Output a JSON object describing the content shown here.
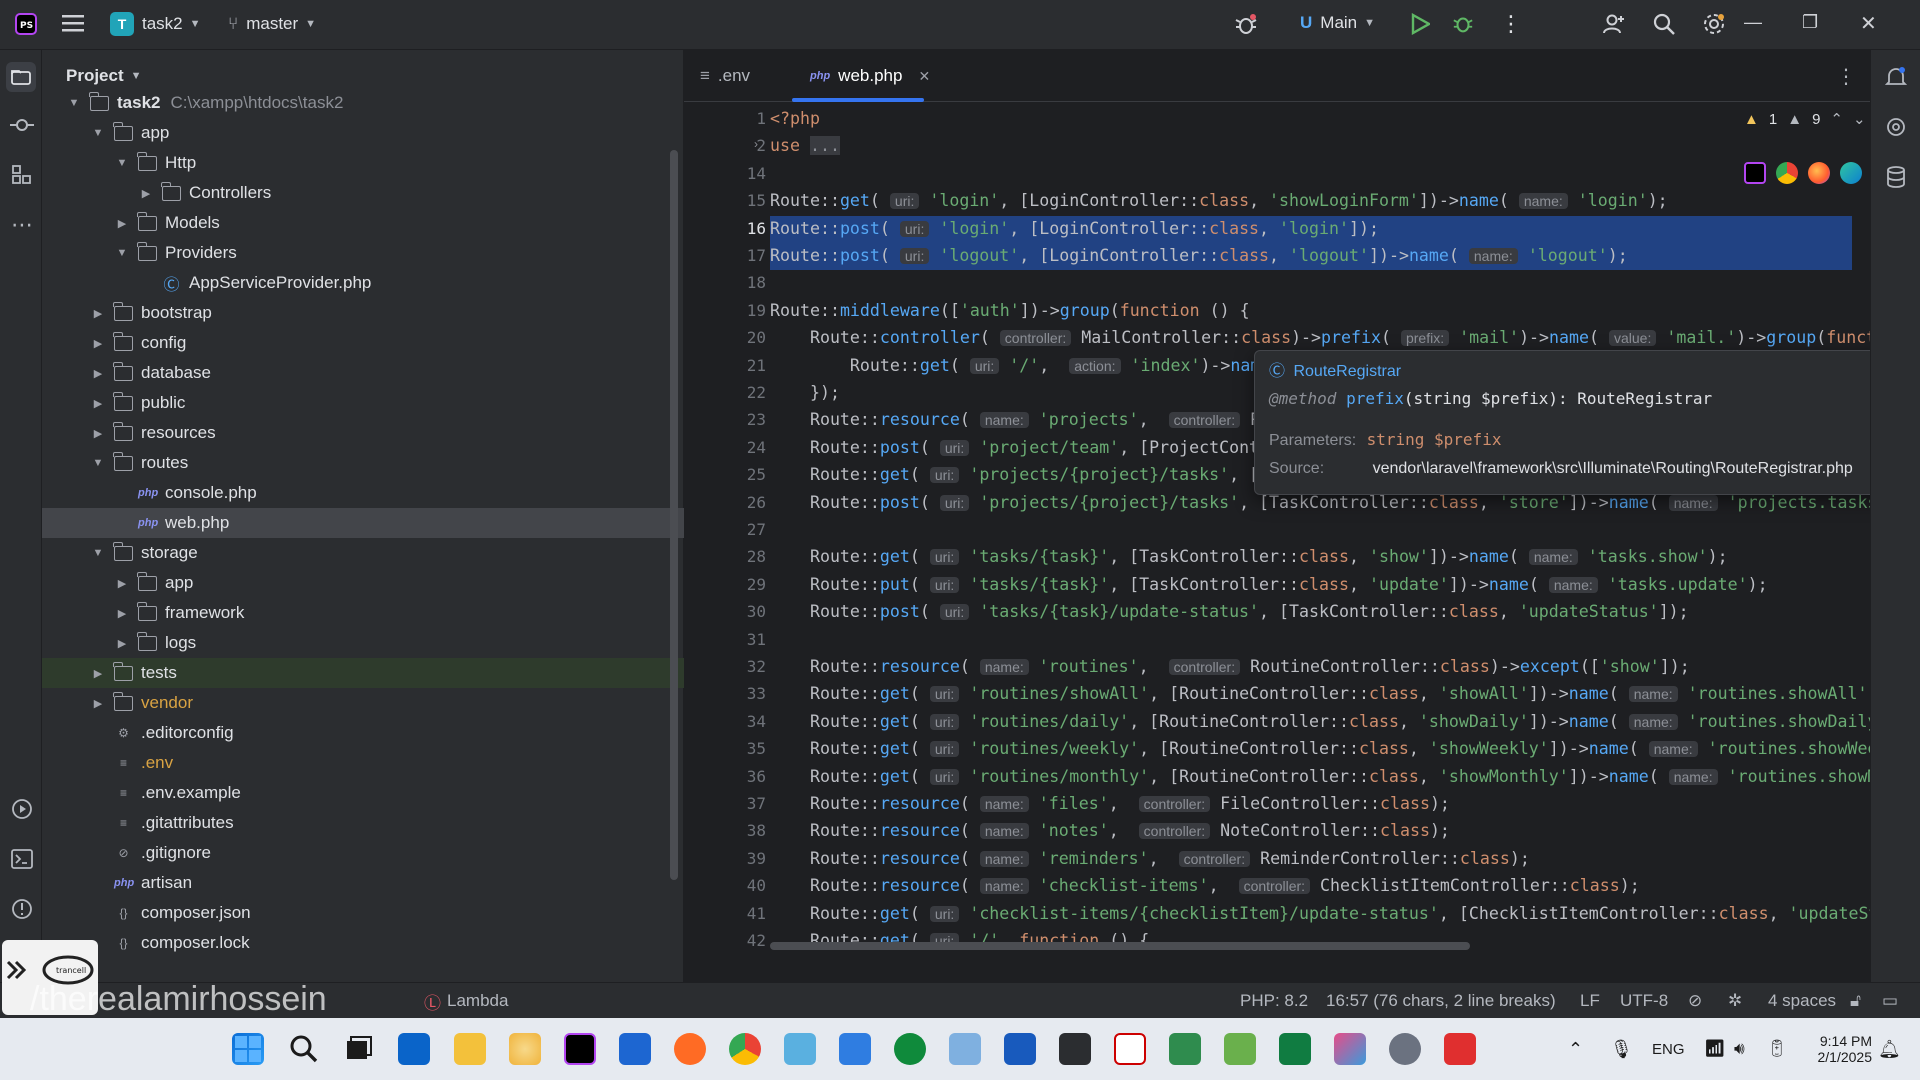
{
  "titlebar": {
    "project_initial": "T",
    "project_name": "task2",
    "branch": "master",
    "run_config": "Main"
  },
  "project_panel": {
    "title": "Project",
    "tree": [
      {
        "label": "task2",
        "path": "C:\\xampp\\htdocs\\task2",
        "type": "folder",
        "depth": 0,
        "expanded": true,
        "bold": true
      },
      {
        "label": "app",
        "type": "folder",
        "depth": 1,
        "expanded": true
      },
      {
        "label": "Http",
        "type": "folder",
        "depth": 2,
        "expanded": true
      },
      {
        "label": "Controllers",
        "type": "folder",
        "depth": 3,
        "expanded": false
      },
      {
        "label": "Models",
        "type": "folder",
        "depth": 2,
        "expanded": false
      },
      {
        "label": "Providers",
        "type": "folder",
        "depth": 2,
        "expanded": true
      },
      {
        "label": "AppServiceProvider.php",
        "type": "class",
        "depth": 3
      },
      {
        "label": "bootstrap",
        "type": "folder",
        "depth": 1,
        "expanded": false
      },
      {
        "label": "config",
        "type": "folder",
        "depth": 1,
        "expanded": false
      },
      {
        "label": "database",
        "type": "folder",
        "depth": 1,
        "expanded": false
      },
      {
        "label": "public",
        "type": "folder",
        "depth": 1,
        "expanded": false
      },
      {
        "label": "resources",
        "type": "folder",
        "depth": 1,
        "expanded": false
      },
      {
        "label": "routes",
        "type": "folder",
        "depth": 1,
        "expanded": true
      },
      {
        "label": "console.php",
        "type": "php",
        "depth": 2
      },
      {
        "label": "web.php",
        "type": "php",
        "depth": 2,
        "selected": true
      },
      {
        "label": "storage",
        "type": "folder",
        "depth": 1,
        "expanded": true
      },
      {
        "label": "app",
        "type": "folder",
        "depth": 2,
        "expanded": false
      },
      {
        "label": "framework",
        "type": "folder",
        "depth": 2,
        "expanded": false
      },
      {
        "label": "logs",
        "type": "folder",
        "depth": 2,
        "expanded": false
      },
      {
        "label": "tests",
        "type": "folder",
        "depth": 1,
        "expanded": false,
        "green": true
      },
      {
        "label": "vendor",
        "type": "folder",
        "depth": 1,
        "expanded": false,
        "orange": true
      },
      {
        "label": ".editorconfig",
        "type": "gear",
        "depth": 1
      },
      {
        "label": ".env",
        "type": "text",
        "depth": 1,
        "orange": true
      },
      {
        "label": ".env.example",
        "type": "text",
        "depth": 1
      },
      {
        "label": ".gitattributes",
        "type": "text",
        "depth": 1
      },
      {
        "label": ".gitignore",
        "type": "ignore",
        "depth": 1
      },
      {
        "label": "artisan",
        "type": "php",
        "depth": 1
      },
      {
        "label": "composer.json",
        "type": "json",
        "depth": 1
      },
      {
        "label": "composer.lock",
        "type": "json",
        "depth": 1
      }
    ]
  },
  "tabs": [
    {
      "label": ".env",
      "active": false
    },
    {
      "label": "web.php",
      "active": true
    }
  ],
  "inspections": {
    "errors": "1",
    "warnings": "9"
  },
  "code_lines": [
    {
      "n": "1",
      "html": "<span class='php-tag'>&lt;?php</span>"
    },
    {
      "n": "2",
      "html": "<span class='kw'>use</span> <span style='background:#393b40;color:#8c8f96'>...</span>"
    },
    {
      "n": "14",
      "html": ""
    },
    {
      "n": "15",
      "html": "Route::<span class='meth'>get</span>( <span class='hint'>uri:</span> <span class='str'>'login'</span>, [LoginController::<span class='kw'>class</span>, <span class='str'>'showLoginForm'</span>])-&gt;<span class='meth'>name</span>( <span class='hint'>name:</span> <span class='str'>'login'</span>);"
    },
    {
      "n": "16",
      "html": "Route::<span class='meth'>post</span>( <span class='hint'>uri:</span> <span class='str'>'login'</span>, [LoginController::<span class='kw'>class</span>, <span class='str'>'login'</span>]);",
      "selected": true,
      "current": true
    },
    {
      "n": "17",
      "html": "Route::<span class='meth'>post</span>( <span class='hint'>uri:</span> <span class='str'>'logout'</span>, [LoginController::<span class='kw'>class</span>, <span class='str'>'logout'</span>])-&gt;<span class='meth'>name</span>( <span class='hint'>name:</span> <span class='str'>'logout'</span>);",
      "selected": true
    },
    {
      "n": "18",
      "html": ""
    },
    {
      "n": "19",
      "html": "Route::<span class='meth'>middleware</span>([<span class='str'>'auth'</span>])-&gt;<span class='meth'>group</span>(<span class='kw'>function</span> () {"
    },
    {
      "n": "20",
      "html": "    Route::<span class='meth'>controller</span>( <span class='hint'>controller:</span> MailController::<span class='kw'>class</span>)-&gt;<span class='meth'>prefix</span>( <span class='hint'>prefix:</span> <span class='str'>'mail'</span>)-&gt;<span class='meth'>name</span>( <span class='hint'>value:</span> <span class='str'>'mail.'</span>)-&gt;<span class='meth'>group</span>(<span class='kw'>functi</span>"
    },
    {
      "n": "21",
      "html": "        Route::<span class='meth'>get</span>( <span class='hint'>uri:</span> <span class='str'>'/'</span>,  <span class='hint'>action:</span> <span class='str'>'index'</span>)-&gt;<span class='meth'>name</span>"
    },
    {
      "n": "22",
      "html": "    });"
    },
    {
      "n": "23",
      "html": "    Route::<span class='meth'>resource</span>( <span class='hint'>name:</span> <span class='str'>'projects'</span>,  <span class='hint'>controller:</span> Pr"
    },
    {
      "n": "24",
      "html": "    Route::<span class='meth'>post</span>( <span class='hint'>uri:</span> <span class='str'>'project/team'</span>, [ProjectContr"
    },
    {
      "n": "25",
      "html": "    Route::<span class='meth'>get</span>( <span class='hint'>uri:</span> <span class='str'>'projects/{project}/tasks'</span>, [T"
    },
    {
      "n": "26",
      "html": "    Route::<span class='meth'>post</span>( <span class='hint'>uri:</span> <span class='str'>'projects/{project}/tasks'</span>, [TaskController::<span class='kw'>class</span>, <span class='str'>'store'</span>])-&gt;<span class='meth'>name</span>( <span class='hint'>name:</span> <span class='str'>'projects.tasks.</span>"
    },
    {
      "n": "27",
      "html": ""
    },
    {
      "n": "28",
      "html": "    Route::<span class='meth'>get</span>( <span class='hint'>uri:</span> <span class='str'>'tasks/{task}'</span>, [TaskController::<span class='kw'>class</span>, <span class='str'>'show'</span>])-&gt;<span class='meth'>name</span>( <span class='hint'>name:</span> <span class='str'>'tasks.show'</span>);"
    },
    {
      "n": "29",
      "html": "    Route::<span class='meth'>put</span>( <span class='hint'>uri:</span> <span class='str'>'tasks/{task}'</span>, [TaskController::<span class='kw'>class</span>, <span class='str'>'update'</span>])-&gt;<span class='meth'>name</span>( <span class='hint'>name:</span> <span class='str'>'tasks.update'</span>);"
    },
    {
      "n": "30",
      "html": "    Route::<span class='meth'>post</span>( <span class='hint'>uri:</span> <span class='str'>'tasks/{task}/update-status'</span>, [TaskController::<span class='kw'>class</span>, <span class='str'>'updateStatus'</span>]);"
    },
    {
      "n": "31",
      "html": ""
    },
    {
      "n": "32",
      "html": "    Route::<span class='meth'>resource</span>( <span class='hint'>name:</span> <span class='str'>'routines'</span>,  <span class='hint'>controller:</span> RoutineController::<span class='kw'>class</span>)-&gt;<span class='meth'>except</span>([<span class='str'>'show'</span>]);"
    },
    {
      "n": "33",
      "html": "    Route::<span class='meth'>get</span>( <span class='hint'>uri:</span> <span class='str'>'routines/showAll'</span>, [RoutineController::<span class='kw'>class</span>, <span class='str'>'showAll'</span>])-&gt;<span class='meth'>name</span>( <span class='hint'>name:</span> <span class='str'>'routines.showAll'</span>);"
    },
    {
      "n": "34",
      "html": "    Route::<span class='meth'>get</span>( <span class='hint'>uri:</span> <span class='str'>'routines/daily'</span>, [RoutineController::<span class='kw'>class</span>, <span class='str'>'showDaily'</span>])-&gt;<span class='meth'>name</span>( <span class='hint'>name:</span> <span class='str'>'routines.showDaily'</span>"
    },
    {
      "n": "35",
      "html": "    Route::<span class='meth'>get</span>( <span class='hint'>uri:</span> <span class='str'>'routines/weekly'</span>, [RoutineController::<span class='kw'>class</span>, <span class='str'>'showWeekly'</span>])-&gt;<span class='meth'>name</span>( <span class='hint'>name:</span> <span class='str'>'routines.showWeek</span>"
    },
    {
      "n": "36",
      "html": "    Route::<span class='meth'>get</span>( <span class='hint'>uri:</span> <span class='str'>'routines/monthly'</span>, [RoutineController::<span class='kw'>class</span>, <span class='str'>'showMonthly'</span>])-&gt;<span class='meth'>name</span>( <span class='hint'>name:</span> <span class='str'>'routines.showMo</span>"
    },
    {
      "n": "37",
      "html": "    Route::<span class='meth'>resource</span>( <span class='hint'>name:</span> <span class='str'>'files'</span>,  <span class='hint'>controller:</span> FileController::<span class='kw'>class</span>);"
    },
    {
      "n": "38",
      "html": "    Route::<span class='meth'>resource</span>( <span class='hint'>name:</span> <span class='str'>'notes'</span>,  <span class='hint'>controller:</span> NoteController::<span class='kw'>class</span>);"
    },
    {
      "n": "39",
      "html": "    Route::<span class='meth'>resource</span>( <span class='hint'>name:</span> <span class='str'>'reminders'</span>,  <span class='hint'>controller:</span> ReminderController::<span class='kw'>class</span>);"
    },
    {
      "n": "40",
      "html": "    Route::<span class='meth'>resource</span>( <span class='hint'>name:</span> <span class='str'>'checklist-items'</span>,  <span class='hint'>controller:</span> ChecklistItemController::<span class='kw'>class</span>);"
    },
    {
      "n": "41",
      "html": "    Route::<span class='meth'>get</span>( <span class='hint'>uri:</span> <span class='str'>'checklist-items/{checklistItem}/update-status'</span>, [ChecklistItemController::<span class='kw'>class</span>, <span class='str'>'updateSt</span>"
    },
    {
      "n": "42",
      "html": "    Route::<span class='meth'>get</span>( <span class='hint'>uri:</span> <span class='str'>'/'</span>, <span class='kw'>function</span> () {"
    }
  ],
  "popup": {
    "title": "RouteRegistrar",
    "method_tag": "@method",
    "method_name": "prefix",
    "method_sig": "(string $prefix): RouteRegistrar",
    "params_label": "Parameters:",
    "params_value": "string $prefix",
    "source_label": "Source:",
    "source_value": "vendor\\laravel\\framework\\src\\Illuminate\\Routing\\RouteRegistrar.php"
  },
  "statusbar": {
    "breadcrumb_last": "Lambda",
    "php_version": "PHP: 8.2",
    "position": "16:57 (76 chars, 2 line breaks)",
    "line_ending": "LF",
    "encoding": "UTF-8",
    "indent": "4 spaces"
  },
  "watermark": {
    "text": "/therealamirhossein"
  },
  "taskbar": {
    "language": "ENG",
    "time": "9:14 PM",
    "date": "2/1/2025"
  },
  "colors": {
    "accent": "#3574f0",
    "selection": "#214283",
    "string": "#6aab73",
    "keyword": "#cf8e6d",
    "method": "#56a8f5"
  }
}
